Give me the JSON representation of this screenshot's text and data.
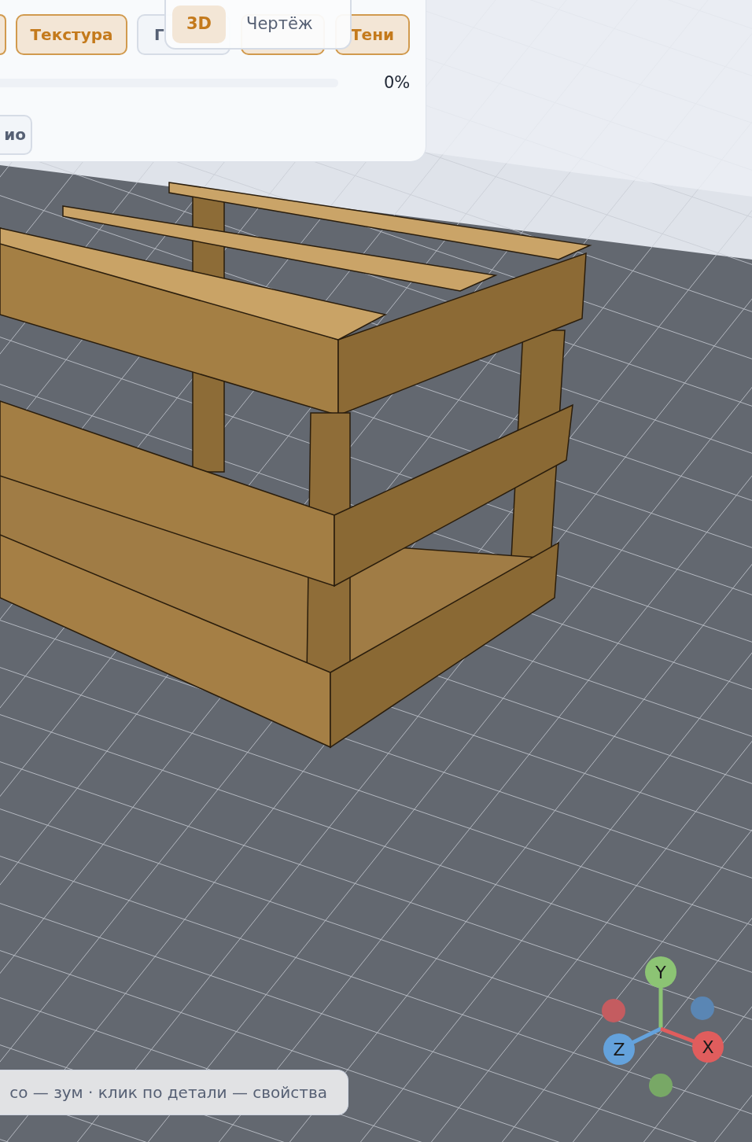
{
  "panel": {
    "chips": [
      {
        "selected": true
      },
      {
        "label": "Текстура",
        "selected": true
      },
      {
        "label": "Г",
        "selected": false
      },
      {
        "selected": true
      },
      {
        "label": "Тени",
        "selected": true
      }
    ],
    "progress": {
      "level": 0,
      "reading": "0%"
    },
    "button": {
      "label": "ио"
    }
  },
  "view_switch": [
    {
      "label": "3D",
      "selected": true
    },
    {
      "label": "Чертёж",
      "selected": false
    }
  ],
  "gizmo": [
    {
      "label": "Y",
      "color": "#8cc474"
    },
    {
      "label": "Z",
      "color": "#64a2dc"
    },
    {
      "label": "X",
      "color": "#e05d5d"
    }
  ],
  "hint": "со — зум · клик по детали — свойства"
}
